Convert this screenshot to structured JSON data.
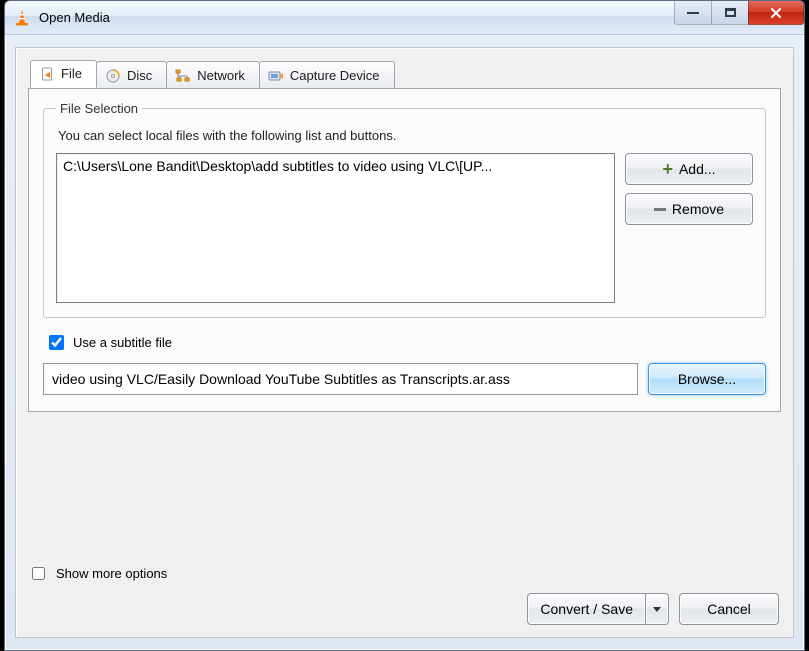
{
  "window": {
    "title": "Open Media"
  },
  "win_controls": {
    "min_name": "minimize",
    "max_name": "maximize",
    "close_name": "close"
  },
  "tabs": {
    "file": "File",
    "disc": "Disc",
    "network": "Network",
    "capture": "Capture Device"
  },
  "file_selection": {
    "legend": "File Selection",
    "hint": "You can select local files with the following list and buttons.",
    "selected_path": "C:\\Users\\Lone Bandit\\Desktop\\add subtitles to video using VLC\\[UP...",
    "add_label": "Add...",
    "remove_label": "Remove"
  },
  "subtitle": {
    "use_label": "Use a subtitle file",
    "checked": true,
    "path": "video using VLC/Easily Download YouTube Subtitles as Transcripts.ar.ass",
    "browse_label": "Browse..."
  },
  "footer": {
    "show_more": "Show more options",
    "convert": "Convert / Save",
    "cancel": "Cancel"
  }
}
